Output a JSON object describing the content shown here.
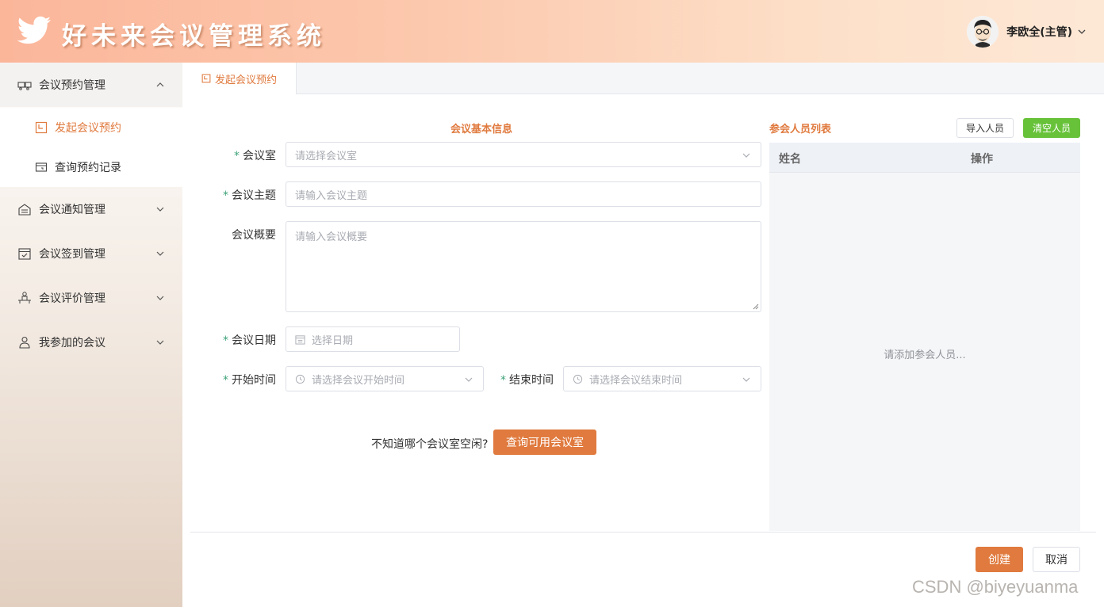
{
  "app": {
    "title": "好未来会议管理系统"
  },
  "user": {
    "name": "李欧全(主管)"
  },
  "sidebar": {
    "groups": [
      {
        "label": "会议预约管理",
        "icon": "meeting-room-icon",
        "expanded": true,
        "items": [
          {
            "label": "发起会议预约",
            "icon": "calendar-icon",
            "active": true
          },
          {
            "label": "查询预约记录",
            "icon": "record-icon",
            "active": false
          }
        ]
      },
      {
        "label": "会议通知管理",
        "icon": "notice-icon"
      },
      {
        "label": "会议签到管理",
        "icon": "checkin-icon"
      },
      {
        "label": "会议评价管理",
        "icon": "review-icon"
      },
      {
        "label": "我参加的会议",
        "icon": "person-icon"
      }
    ]
  },
  "tabs": [
    {
      "label": "发起会议预约",
      "active": true
    }
  ],
  "form": {
    "section_title": "会议基本信息",
    "room": {
      "label": "会议室",
      "placeholder": "请选择会议室"
    },
    "subject": {
      "label": "会议主题",
      "placeholder": "请输入会议主题"
    },
    "summary": {
      "label": "会议概要",
      "placeholder": "请输入会议概要"
    },
    "date": {
      "label": "会议日期",
      "placeholder": "选择日期"
    },
    "start_time": {
      "label": "开始时间",
      "placeholder": "请选择会议开始时间"
    },
    "end_time": {
      "label": "结束时间",
      "placeholder": "请选择会议结束时间"
    },
    "room_hint": "不知道哪个会议室空闲?",
    "query_rooms_button": "查询可用会议室"
  },
  "attendees": {
    "title": "参会人员列表",
    "import_button": "导入人员",
    "clear_button": "清空人员",
    "columns": [
      "姓名",
      "操作"
    ],
    "empty_text": "请添加参会人员..."
  },
  "actions": {
    "create_button": "创建",
    "cancel_button": "取消"
  },
  "watermark": "CSDN @biyeyuanma",
  "colors": {
    "accent": "#e07a3e",
    "success": "#67c23a",
    "required_mark": "#3fa37a"
  }
}
